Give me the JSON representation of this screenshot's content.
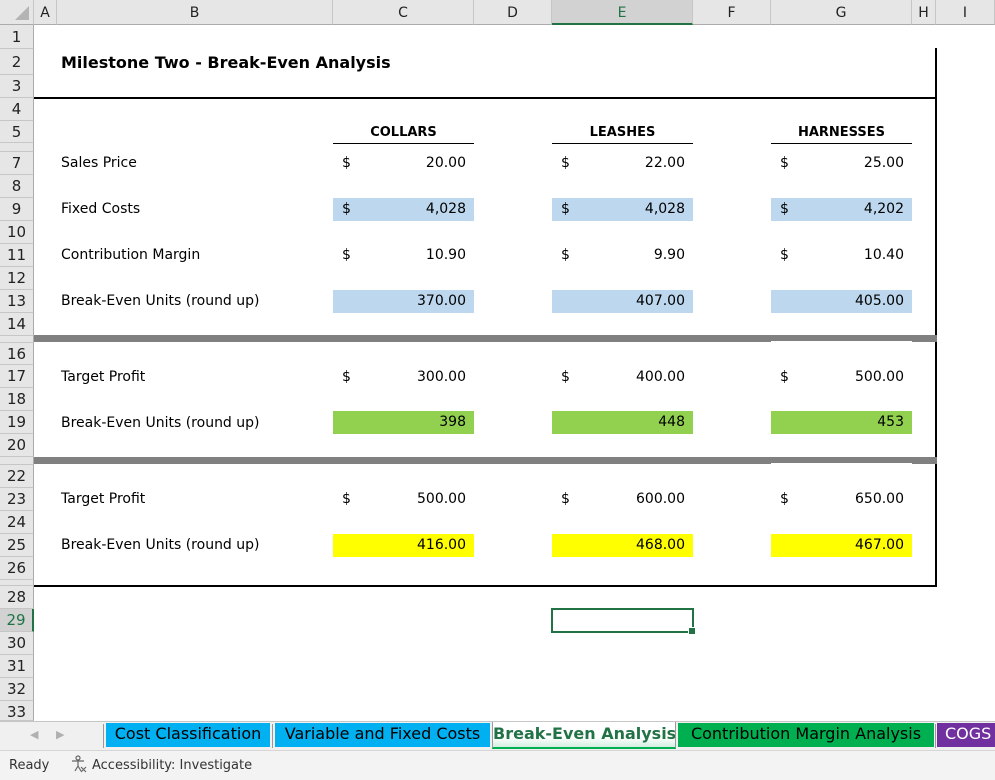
{
  "app": {
    "selected_cell": "E29",
    "column_headers": [
      "A",
      "B",
      "C",
      "D",
      "E",
      "F",
      "G",
      "H",
      "I"
    ],
    "row_headers": [
      "1",
      "2",
      "3",
      "4",
      "5",
      "7",
      "8",
      "9",
      "10",
      "11",
      "12",
      "13",
      "14",
      "16",
      "17",
      "18",
      "19",
      "20",
      "22",
      "23",
      "24",
      "25",
      "26",
      "28",
      "29",
      "30",
      "31",
      "32",
      "33"
    ]
  },
  "sheet": {
    "title": "Milestone Two - Break-Even Analysis",
    "products": [
      "COLLARS",
      "LEASHES",
      "HARNESSES"
    ],
    "currency_symbol": "$",
    "section1": {
      "sales_price": {
        "label": "Sales Price",
        "values": [
          "20.00",
          "22.00",
          "25.00"
        ]
      },
      "fixed_costs": {
        "label": "Fixed Costs",
        "values": [
          "4,028",
          "4,028",
          "4,202"
        ]
      },
      "contribution_margin": {
        "label": "Contribution Margin",
        "values": [
          "10.90",
          "9.90",
          "10.40"
        ]
      },
      "break_even_units": {
        "label": "Break-Even Units (round up)",
        "values": [
          "370.00",
          "407.00",
          "405.00"
        ]
      }
    },
    "section2": {
      "target_profit": {
        "label": "Target Profit",
        "values": [
          "300.00",
          "400.00",
          "500.00"
        ]
      },
      "break_even_units": {
        "label": "Break-Even Units (round up)",
        "values": [
          "398",
          "448",
          "453"
        ]
      }
    },
    "section3": {
      "target_profit": {
        "label": "Target Profit",
        "values": [
          "500.00",
          "600.00",
          "650.00"
        ]
      },
      "break_even_units": {
        "label": "Break-Even Units (round up)",
        "values": [
          "416.00",
          "468.00",
          "467.00"
        ]
      }
    },
    "colors": {
      "fixed_costs_fill": "#bdd7ee",
      "section2_fill": "#92d050",
      "section3_fill": "#ffff00",
      "separator": "#808080",
      "selection": "#217346"
    }
  },
  "tabs": [
    {
      "label": "Cost Classification",
      "color": "#00b0f0",
      "active": false
    },
    {
      "label": "Variable and Fixed Costs",
      "color": "#00b0f0",
      "active": false
    },
    {
      "label": "Break-Even Analysis",
      "color": "#00b050",
      "active": true
    },
    {
      "label": "Contribution Margin Analysis",
      "color": "#00b050",
      "active": false
    },
    {
      "label": "COGS",
      "color": "#7030a0",
      "active": false
    }
  ],
  "status": {
    "ready": "Ready",
    "accessibility": "Accessibility: Investigate"
  }
}
